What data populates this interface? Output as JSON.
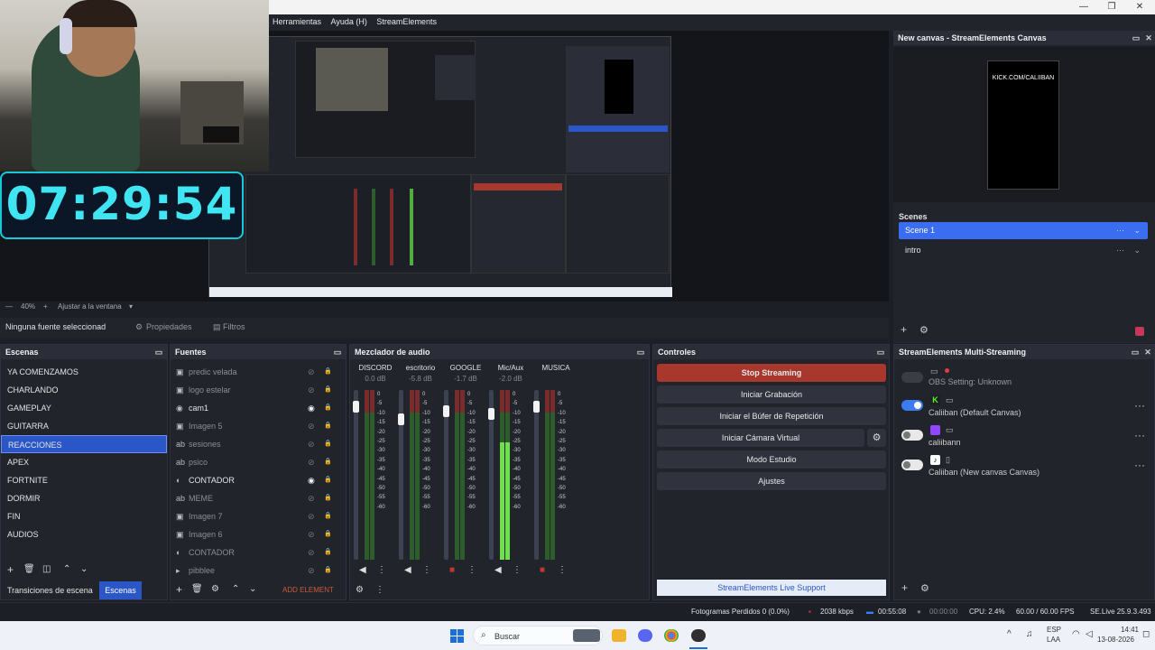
{
  "menu": {
    "items": [
      "Herramientas",
      "Ayuda (H)",
      "StreamElements"
    ]
  },
  "overlay": {
    "timer": "07:29:54"
  },
  "preview": {
    "zoom": "40%",
    "fit_label": "Ajustar a la ventana"
  },
  "source_bar": {
    "none_selected": "Ninguna fuente seleccionad",
    "properties": "Propiedades",
    "filters": "Filtros"
  },
  "canvas_panel": {
    "title": "New canvas - StreamElements Canvas",
    "canvas_text": "KICK.COM/CALIIBAN",
    "scenes_label": "Scenes",
    "scenes": [
      "Scene 1",
      "intro"
    ]
  },
  "scenes_panel": {
    "title": "Escenas",
    "items": [
      "YA COMENZAMOS",
      "CHARLANDO",
      "GAMEPLAY",
      "GUITARRA",
      "REACCIONES",
      "APEX",
      "FORTNITE",
      "DORMIR",
      "FIN",
      "AUDIOS"
    ],
    "selected": "REACCIONES",
    "tab_transitions": "Transiciones de escena",
    "tab_scenes": "Escenas"
  },
  "sources_panel": {
    "title": "Fuentes",
    "items": [
      {
        "name": "predic velada",
        "visible": false
      },
      {
        "name": "logo estelar",
        "visible": false
      },
      {
        "name": "cam1",
        "visible": true
      },
      {
        "name": "Imagen 5",
        "visible": false
      },
      {
        "name": "sesiones",
        "visible": false
      },
      {
        "name": "psico",
        "visible": false
      },
      {
        "name": "CONTADOR",
        "visible": true
      },
      {
        "name": "MEME",
        "visible": false
      },
      {
        "name": "Imagen 7",
        "visible": false
      },
      {
        "name": "Imagen 6",
        "visible": false
      },
      {
        "name": "CONTADOR",
        "visible": false
      },
      {
        "name": "pibblee",
        "visible": false
      }
    ],
    "add_element": "ADD ELEMENT"
  },
  "mixer_panel": {
    "title": "Mezclador de audio",
    "channels": [
      {
        "name": "DISCORD",
        "db": "0.0 dB",
        "level": 0.9
      },
      {
        "name": "escritorio",
        "db": "-5.8 dB",
        "level": 0.78
      },
      {
        "name": "GOOGLE",
        "db": "-1.7 dB",
        "level": 0.86
      },
      {
        "name": "Mic/Aux",
        "db": "-2.0 dB",
        "level": 0.83
      },
      {
        "name": "MUSICA",
        "db": "",
        "level": 0.9
      }
    ],
    "scale": [
      "0",
      "-5",
      "-10",
      "-15",
      "-20",
      "-25",
      "-30",
      "-35",
      "-40",
      "-45",
      "-50",
      "-55",
      "-60"
    ]
  },
  "controls_panel": {
    "title": "Controles",
    "stop_streaming": "Stop Streaming",
    "start_recording": "Iniciar Grabación",
    "replay_buffer": "Iniciar el Búfer de Repetición",
    "virtual_cam": "Iniciar Cámara Virtual",
    "studio_mode": "Modo Estudio",
    "settings": "Ajustes",
    "support": "StreamElements Live Support"
  },
  "multistream_panel": {
    "title": "StreamElements Multi-Streaming",
    "obs_setting": "OBS Setting: Unknown",
    "rows": [
      {
        "label": "Caliiban (Default Canvas)",
        "enabled": true
      },
      {
        "label": "caliibann",
        "enabled": false
      },
      {
        "label": "Caliiban (New canvas Canvas)",
        "enabled": false
      }
    ]
  },
  "status": {
    "dropped": "Fotogramas Perdidos 0 (0.0%)",
    "kbps": "2038 kbps",
    "stream_time": "00:55:08",
    "rec_time": "00:00:00",
    "cpu": "CPU: 2.4%",
    "fps": "60.00 / 60.00 FPS",
    "version": "SE.Live 25.9.3.493"
  },
  "taskbar": {
    "search": "Buscar",
    "lang1": "ESP",
    "lang2": "LAA",
    "time": "14:41",
    "date": "13-08-2026"
  }
}
